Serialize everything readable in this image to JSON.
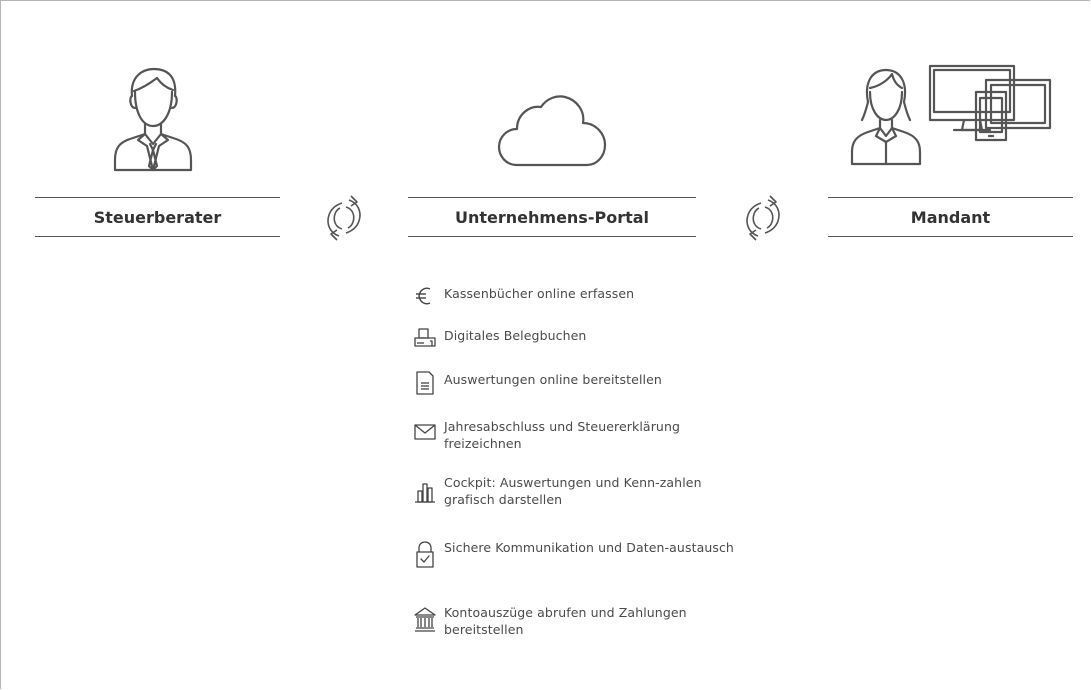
{
  "roles": {
    "left": {
      "label": "Steuerberater",
      "icon": "businessman-icon"
    },
    "center": {
      "label": "Unternehmens-Portal",
      "icon": "cloud-icon"
    },
    "right": {
      "label": "Mandant",
      "icon": "client-devices-icon"
    }
  },
  "sync_icons": [
    "sync-icon",
    "sync-icon"
  ],
  "features": [
    {
      "icon": "euro-icon",
      "text": "Kassenbücher online erfassen"
    },
    {
      "icon": "scanner-icon",
      "text": "Digitales Belegbuchen"
    },
    {
      "icon": "document-icon",
      "text": "Auswertungen online bereitstellen"
    },
    {
      "icon": "envelope-icon",
      "text": "Jahresabschluss und Steuererklärung freizeichnen"
    },
    {
      "icon": "bar-chart-icon",
      "text": "Cockpit: Auswertungen und Kenn-zahlen grafisch darstellen"
    },
    {
      "icon": "padlock-icon",
      "text": "Sichere Kommunikation und Daten-austausch"
    },
    {
      "icon": "bank-icon",
      "text": "Kontoauszüge abrufen und Zahlungen bereitstellen"
    }
  ],
  "colors": {
    "stroke": "#555555",
    "text": "#333333",
    "border": "#b5b5b5"
  }
}
